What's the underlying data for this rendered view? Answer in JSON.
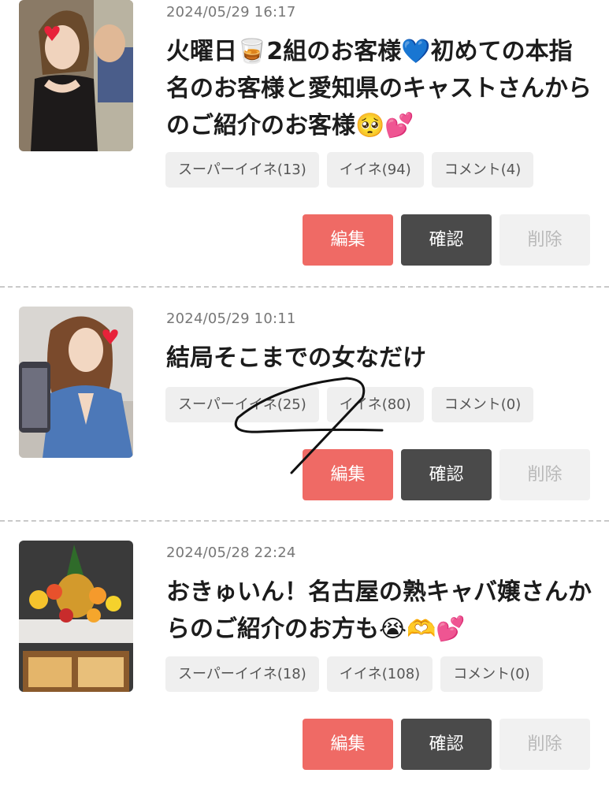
{
  "posts": [
    {
      "date": "2024/05/29 16:17",
      "title": "火曜日🥃2組のお客様💙初めての本指名のお客様と愛知県のキャストさんからのご紹介のお客様🥺💕",
      "chips": [
        "スーパーイイネ(13)",
        "イイネ(94)",
        "コメント(4)"
      ],
      "edit_label": "編集",
      "confirm_label": "確認",
      "delete_label": "削除"
    },
    {
      "date": "2024/05/29 10:11",
      "title": "結局そこまでの女なだけ",
      "chips": [
        "スーパーイイネ(25)",
        "イイネ(80)",
        "コメント(0)"
      ],
      "edit_label": "編集",
      "confirm_label": "確認",
      "delete_label": "削除"
    },
    {
      "date": "2024/05/28 22:24",
      "title": "おきゅいん！名古屋の熟キャバ嬢さんからのご紹介のお方も😭🫶💕",
      "chips": [
        "スーパーイイネ(18)",
        "イイネ(108)",
        "コメント(0)"
      ],
      "edit_label": "編集",
      "confirm_label": "確認",
      "delete_label": "削除"
    }
  ],
  "colors": {
    "edit": "#ef6a65",
    "confirm": "#4a4a4a",
    "delete": "#f1f1f1",
    "chip": "#efefef"
  }
}
